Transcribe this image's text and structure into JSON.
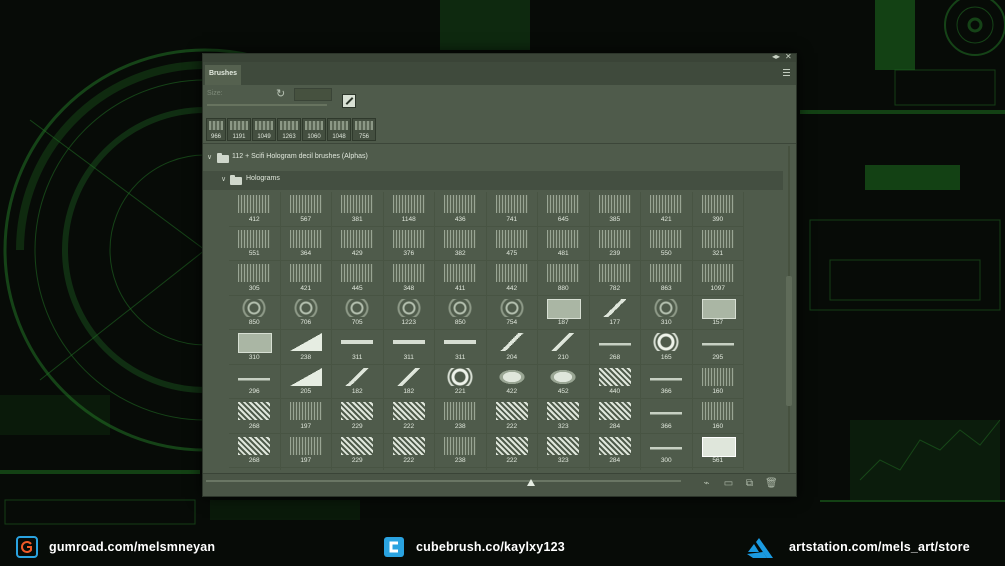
{
  "panel": {
    "tab_label": "Brushes",
    "size_label": "Size:",
    "recent_brushes": [
      "966",
      "1191",
      "1049",
      "1263",
      "1060",
      "1048",
      "756"
    ],
    "group": {
      "label": "112 + Scifi  Hologram decil brushes (Alphas)",
      "subgroup": "Holograms"
    },
    "grid": [
      [
        "412",
        "567",
        "381",
        "1148",
        "436",
        "741",
        "645",
        "385",
        "421",
        "390"
      ],
      [
        "551",
        "364",
        "429",
        "376",
        "382",
        "475",
        "481",
        "239",
        "550",
        "321"
      ],
      [
        "305",
        "421",
        "445",
        "348",
        "411",
        "442",
        "880",
        "782",
        "863",
        "1097"
      ],
      [
        "850",
        "706",
        "705",
        "1223",
        "850",
        "754",
        "187",
        "177",
        "310",
        "157"
      ],
      [
        "310",
        "238",
        "311",
        "311",
        "311",
        "204",
        "210",
        "268",
        "165",
        "295"
      ],
      [
        "296",
        "205",
        "182",
        "182",
        "221",
        "422",
        "452",
        "440",
        "366",
        "160"
      ],
      [
        "268",
        "197",
        "229",
        "222",
        "238",
        "222",
        "323",
        "284",
        "366",
        "160"
      ],
      [
        "268",
        "197",
        "229",
        "222",
        "238",
        "222",
        "323",
        "284",
        "300",
        "561"
      ],
      [
        "",
        "",
        "",
        "",
        "",
        "",
        "",
        "",
        "",
        ""
      ]
    ]
  },
  "footer": {
    "gumroad": "gumroad.com/melsmneyan",
    "cubebrush": "cubebrush.co/kaylxy123",
    "artstation": "artstation.com/mels_art/store"
  },
  "colors": {
    "panel_bg": "#4f5b4b",
    "hud_green": "#39c13b",
    "cubebrush_blue": "#2aa3e0",
    "artstation_blue": "#1b9ae0",
    "gumroad_orange": "#f05a28"
  }
}
